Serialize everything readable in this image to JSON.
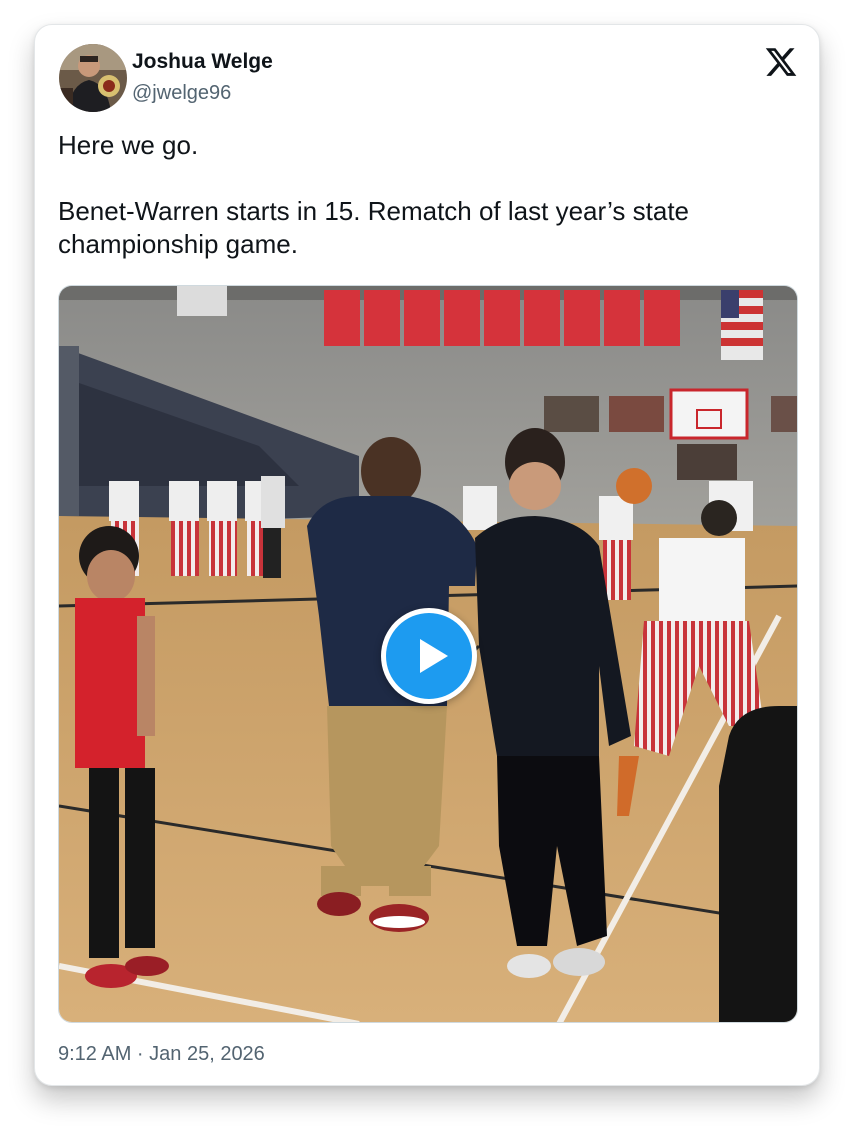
{
  "author": {
    "display_name": "Joshua Welge",
    "handle": "@jwelge96",
    "avatar_icon": "profile-photo"
  },
  "brand": {
    "logo_icon": "x-logo-icon"
  },
  "tweet": {
    "paragraphs": [
      "Here we go.",
      "Benet-Warren starts in 15. Rematch of last year’s state championship game."
    ],
    "timestamp": "9:12 AM · Jan 25, 2026"
  },
  "media": {
    "type": "video",
    "play_icon": "play-icon"
  },
  "colors": {
    "accent": "#1d9bf0",
    "text_primary": "#0f1419",
    "text_secondary": "#536471"
  }
}
